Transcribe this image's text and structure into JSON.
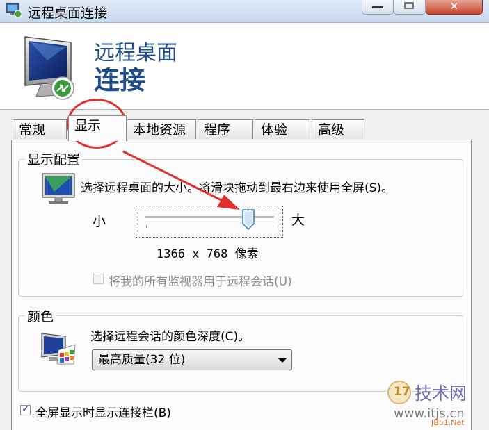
{
  "window": {
    "title": "远程桌面连接",
    "minimize_glyph": "",
    "close_glyph": "✕"
  },
  "header": {
    "title_line1": "远程桌面",
    "title_line2": "连接"
  },
  "tabs": [
    {
      "label": "常规",
      "active": false
    },
    {
      "label": "显示",
      "active": true
    },
    {
      "label": "本地资源",
      "active": false
    },
    {
      "label": "程序",
      "active": false
    },
    {
      "label": "体验",
      "active": false
    },
    {
      "label": "高级",
      "active": false
    }
  ],
  "display_config": {
    "group_label": "显示配置",
    "description": "选择远程桌面的大小。将滑块拖动到最右边来使用全屏(S)。",
    "slider_min_label": "小",
    "slider_max_label": "大",
    "slider_position": 0.8,
    "resolution_value": "1366 x 768",
    "resolution_unit": "像素",
    "all_monitors_label": "将我的所有监视器用于远程会话(U)",
    "all_monitors_checked": false,
    "all_monitors_enabled": false
  },
  "color": {
    "group_label": "颜色",
    "description": "选择远程会话的颜色深度(C)。",
    "selected_option": "最高质量(32 位)"
  },
  "fullscreen_bar": {
    "label": "全屏显示时显示连接栏(B)",
    "checked": true
  },
  "watermark": {
    "number": "17",
    "main": "技术网",
    "url": "www.itjs.cn",
    "small": "JB51.Net"
  },
  "colors": {
    "header_text": "#1f4d8c",
    "annotation_red": "#e0302b"
  }
}
